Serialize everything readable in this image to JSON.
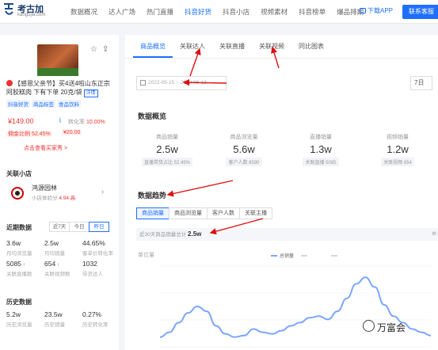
{
  "brand": {
    "name": "考古加",
    "sub": "kaogujia.com"
  },
  "nav": [
    "数据概况",
    "达人广场",
    "热门直播",
    "抖音好货",
    "抖音小店",
    "视频素材",
    "抖音榜单",
    "爆品排期"
  ],
  "nav_active": 3,
  "download_label": "下载APP",
  "contact_label": "联系客服",
  "product": {
    "title": "【感恩父亲节】买4送4啦山东正宗阿胶糕肉 下有下单 20克/袋",
    "detail_link": "详情",
    "labels": [
      "抖音好货",
      "商品标签",
      "食品饮料"
    ],
    "price": "¥149.00",
    "ratio_label": "转化率",
    "ratio_value": "10.00%",
    "commission": "佣金比例 52.45%",
    "sub_label": "¥20.00",
    "link": "点击查看买家秀 >"
  },
  "shop": {
    "section": "关联小店",
    "name": "鸿源园林",
    "stats_prefix": "小店体验分",
    "stats_value": "4.94",
    "stats_badge": "高"
  },
  "recent": {
    "section": "近期数据",
    "tabs": [
      "近7天",
      "今日",
      "昨日"
    ],
    "active": 2,
    "cells": [
      {
        "val": "3.6w",
        "lab": "月均浏览量"
      },
      {
        "val": "2.5w",
        "lab": "月均销量"
      },
      {
        "val": "44.65%",
        "lab": "客单价转化率"
      },
      {
        "val": "5085",
        "lab": "关联直播数",
        "u": "↑"
      },
      {
        "val": "654",
        "lab": "关联视频数",
        "u": "↑"
      },
      {
        "val": "1032",
        "lab": "带货达人"
      }
    ]
  },
  "history": {
    "section": "历史数据",
    "cells": [
      {
        "val": "5.2w",
        "lab": "历史浏览量"
      },
      {
        "val": "23.5w",
        "lab": "历史销量"
      },
      {
        "val": "0.27%",
        "lab": "历史转化率"
      }
    ]
  },
  "main_tabs": [
    "商品概览",
    "关联达人",
    "关联直播",
    "关联视频",
    "同比图表"
  ],
  "main_active": 0,
  "date_range": "2022-05-15 ~ 2022-06-13",
  "date_dropdown": "7日",
  "overview_title": "数据概览",
  "overview": [
    {
      "lab": "商品销量",
      "val": "2.5w",
      "sub": "直播带货占比 52.45%"
    },
    {
      "lab": "商品浏览量",
      "val": "5.6w",
      "sub": "客户人数 8590"
    },
    {
      "lab": "直播销量",
      "val": "1.3w",
      "sub": "关联直播 5085"
    },
    {
      "lab": "视频销量",
      "val": "1.2w",
      "sub": "关联视频 654"
    }
  ],
  "trend_title": "数据趋势",
  "trend_tabs": [
    "商品销量",
    "商品浏览量",
    "客户人数",
    "关联主播"
  ],
  "trend_active": 0,
  "info_bar": {
    "prefix": "近30天商品销量总计",
    "value": "2.5w"
  },
  "chart_data": {
    "type": "line",
    "ylabel": "单位量",
    "series": [
      {
        "name": "总销量",
        "color": "#7aa6ff",
        "values": [
          0.12,
          0.18,
          0.3,
          0.42,
          0.5,
          0.44,
          0.26,
          0.16,
          0.12,
          0.14,
          0.22,
          0.18,
          0.16,
          0.2,
          0.26,
          0.3,
          0.36,
          0.38,
          0.34,
          0.44,
          0.6,
          0.78,
          0.86,
          0.74,
          0.52,
          0.38,
          0.3,
          0.22,
          0.18,
          0.14
        ]
      },
      {
        "name": "",
        "color": "#cfd8e8",
        "values": []
      },
      {
        "name": "",
        "color": "#cfd8e8",
        "values": []
      }
    ],
    "ylim": [
      0,
      1
    ]
  },
  "watermark": "万富会"
}
